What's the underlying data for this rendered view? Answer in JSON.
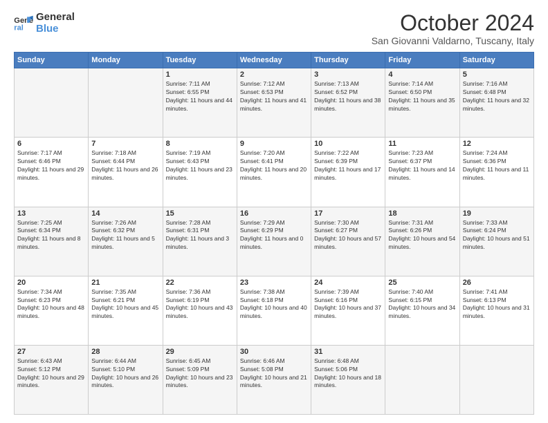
{
  "logo": {
    "line1": "General",
    "line2": "Blue"
  },
  "header": {
    "month": "October 2024",
    "location": "San Giovanni Valdarno, Tuscany, Italy"
  },
  "weekdays": [
    "Sunday",
    "Monday",
    "Tuesday",
    "Wednesday",
    "Thursday",
    "Friday",
    "Saturday"
  ],
  "weeks": [
    [
      {
        "day": "",
        "sunrise": "",
        "sunset": "",
        "daylight": ""
      },
      {
        "day": "",
        "sunrise": "",
        "sunset": "",
        "daylight": ""
      },
      {
        "day": "1",
        "sunrise": "Sunrise: 7:11 AM",
        "sunset": "Sunset: 6:55 PM",
        "daylight": "Daylight: 11 hours and 44 minutes."
      },
      {
        "day": "2",
        "sunrise": "Sunrise: 7:12 AM",
        "sunset": "Sunset: 6:53 PM",
        "daylight": "Daylight: 11 hours and 41 minutes."
      },
      {
        "day": "3",
        "sunrise": "Sunrise: 7:13 AM",
        "sunset": "Sunset: 6:52 PM",
        "daylight": "Daylight: 11 hours and 38 minutes."
      },
      {
        "day": "4",
        "sunrise": "Sunrise: 7:14 AM",
        "sunset": "Sunset: 6:50 PM",
        "daylight": "Daylight: 11 hours and 35 minutes."
      },
      {
        "day": "5",
        "sunrise": "Sunrise: 7:16 AM",
        "sunset": "Sunset: 6:48 PM",
        "daylight": "Daylight: 11 hours and 32 minutes."
      }
    ],
    [
      {
        "day": "6",
        "sunrise": "Sunrise: 7:17 AM",
        "sunset": "Sunset: 6:46 PM",
        "daylight": "Daylight: 11 hours and 29 minutes."
      },
      {
        "day": "7",
        "sunrise": "Sunrise: 7:18 AM",
        "sunset": "Sunset: 6:44 PM",
        "daylight": "Daylight: 11 hours and 26 minutes."
      },
      {
        "day": "8",
        "sunrise": "Sunrise: 7:19 AM",
        "sunset": "Sunset: 6:43 PM",
        "daylight": "Daylight: 11 hours and 23 minutes."
      },
      {
        "day": "9",
        "sunrise": "Sunrise: 7:20 AM",
        "sunset": "Sunset: 6:41 PM",
        "daylight": "Daylight: 11 hours and 20 minutes."
      },
      {
        "day": "10",
        "sunrise": "Sunrise: 7:22 AM",
        "sunset": "Sunset: 6:39 PM",
        "daylight": "Daylight: 11 hours and 17 minutes."
      },
      {
        "day": "11",
        "sunrise": "Sunrise: 7:23 AM",
        "sunset": "Sunset: 6:37 PM",
        "daylight": "Daylight: 11 hours and 14 minutes."
      },
      {
        "day": "12",
        "sunrise": "Sunrise: 7:24 AM",
        "sunset": "Sunset: 6:36 PM",
        "daylight": "Daylight: 11 hours and 11 minutes."
      }
    ],
    [
      {
        "day": "13",
        "sunrise": "Sunrise: 7:25 AM",
        "sunset": "Sunset: 6:34 PM",
        "daylight": "Daylight: 11 hours and 8 minutes."
      },
      {
        "day": "14",
        "sunrise": "Sunrise: 7:26 AM",
        "sunset": "Sunset: 6:32 PM",
        "daylight": "Daylight: 11 hours and 5 minutes."
      },
      {
        "day": "15",
        "sunrise": "Sunrise: 7:28 AM",
        "sunset": "Sunset: 6:31 PM",
        "daylight": "Daylight: 11 hours and 3 minutes."
      },
      {
        "day": "16",
        "sunrise": "Sunrise: 7:29 AM",
        "sunset": "Sunset: 6:29 PM",
        "daylight": "Daylight: 11 hours and 0 minutes."
      },
      {
        "day": "17",
        "sunrise": "Sunrise: 7:30 AM",
        "sunset": "Sunset: 6:27 PM",
        "daylight": "Daylight: 10 hours and 57 minutes."
      },
      {
        "day": "18",
        "sunrise": "Sunrise: 7:31 AM",
        "sunset": "Sunset: 6:26 PM",
        "daylight": "Daylight: 10 hours and 54 minutes."
      },
      {
        "day": "19",
        "sunrise": "Sunrise: 7:33 AM",
        "sunset": "Sunset: 6:24 PM",
        "daylight": "Daylight: 10 hours and 51 minutes."
      }
    ],
    [
      {
        "day": "20",
        "sunrise": "Sunrise: 7:34 AM",
        "sunset": "Sunset: 6:23 PM",
        "daylight": "Daylight: 10 hours and 48 minutes."
      },
      {
        "day": "21",
        "sunrise": "Sunrise: 7:35 AM",
        "sunset": "Sunset: 6:21 PM",
        "daylight": "Daylight: 10 hours and 45 minutes."
      },
      {
        "day": "22",
        "sunrise": "Sunrise: 7:36 AM",
        "sunset": "Sunset: 6:19 PM",
        "daylight": "Daylight: 10 hours and 43 minutes."
      },
      {
        "day": "23",
        "sunrise": "Sunrise: 7:38 AM",
        "sunset": "Sunset: 6:18 PM",
        "daylight": "Daylight: 10 hours and 40 minutes."
      },
      {
        "day": "24",
        "sunrise": "Sunrise: 7:39 AM",
        "sunset": "Sunset: 6:16 PM",
        "daylight": "Daylight: 10 hours and 37 minutes."
      },
      {
        "day": "25",
        "sunrise": "Sunrise: 7:40 AM",
        "sunset": "Sunset: 6:15 PM",
        "daylight": "Daylight: 10 hours and 34 minutes."
      },
      {
        "day": "26",
        "sunrise": "Sunrise: 7:41 AM",
        "sunset": "Sunset: 6:13 PM",
        "daylight": "Daylight: 10 hours and 31 minutes."
      }
    ],
    [
      {
        "day": "27",
        "sunrise": "Sunrise: 6:43 AM",
        "sunset": "Sunset: 5:12 PM",
        "daylight": "Daylight: 10 hours and 29 minutes."
      },
      {
        "day": "28",
        "sunrise": "Sunrise: 6:44 AM",
        "sunset": "Sunset: 5:10 PM",
        "daylight": "Daylight: 10 hours and 26 minutes."
      },
      {
        "day": "29",
        "sunrise": "Sunrise: 6:45 AM",
        "sunset": "Sunset: 5:09 PM",
        "daylight": "Daylight: 10 hours and 23 minutes."
      },
      {
        "day": "30",
        "sunrise": "Sunrise: 6:46 AM",
        "sunset": "Sunset: 5:08 PM",
        "daylight": "Daylight: 10 hours and 21 minutes."
      },
      {
        "day": "31",
        "sunrise": "Sunrise: 6:48 AM",
        "sunset": "Sunset: 5:06 PM",
        "daylight": "Daylight: 10 hours and 18 minutes."
      },
      {
        "day": "",
        "sunrise": "",
        "sunset": "",
        "daylight": ""
      },
      {
        "day": "",
        "sunrise": "",
        "sunset": "",
        "daylight": ""
      }
    ]
  ]
}
